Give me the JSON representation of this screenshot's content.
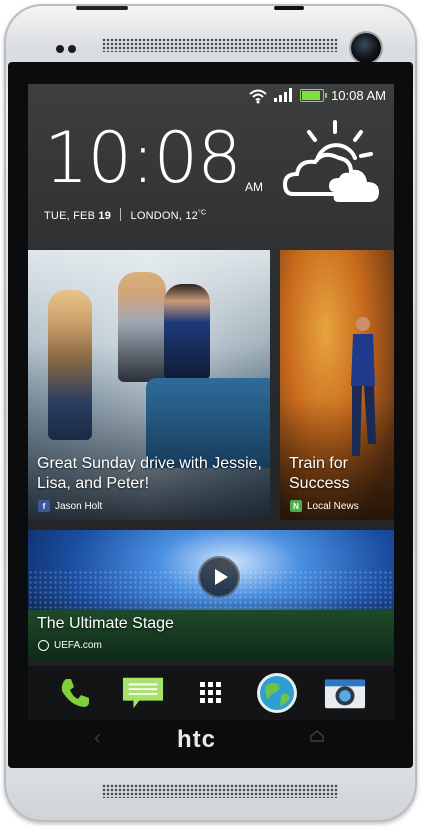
{
  "status": {
    "time": "10:08 AM"
  },
  "clock": {
    "time": "10:08",
    "ampm": "AM"
  },
  "date": {
    "day": "TUE, FEB",
    "date_num": "19",
    "location": "LONDON, 12",
    "unit": "°C"
  },
  "tiles": [
    {
      "title": "Great Sunday drive with Jessie, Lisa, and Peter!",
      "source": "Jason Holt",
      "source_icon": "facebook-icon"
    },
    {
      "title": "Train for Success",
      "source": "Local News",
      "source_icon": "news-icon"
    },
    {
      "title": "The Ultimate Stage",
      "source": "UEFA.com",
      "source_icon": "uefa-icon"
    }
  ],
  "dock": [
    "phone-icon",
    "messages-icon",
    "apps-grid-icon",
    "browser-globe-icon",
    "camera-icon"
  ],
  "brand": "htc",
  "colors": {
    "battery": "#7de03a",
    "facebook": "#3b5998",
    "news": "#4cae4c"
  }
}
